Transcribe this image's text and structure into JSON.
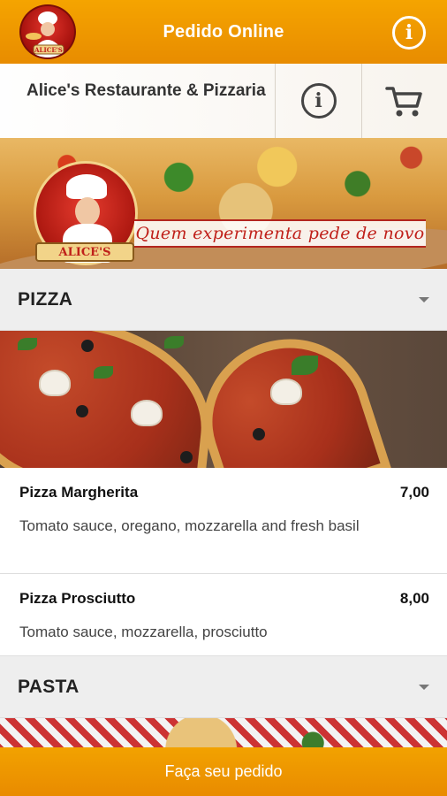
{
  "app_bar": {
    "title": "Pedido Online",
    "logo_text": "ALICE'S",
    "logo_icon": "chef-logo-icon",
    "info_icon": "info-icon"
  },
  "restaurant": {
    "name": "Alice's Restaurante & Pizzaria",
    "info_icon": "info-icon",
    "cart_icon": "cart-icon"
  },
  "banner": {
    "badge_text": "ALICE'S",
    "slogan": "Quem experimenta pede de novo"
  },
  "categories": [
    {
      "title": "PIZZA",
      "expand_icon": "chevron-down-icon",
      "items": [
        {
          "name": "Pizza Margherita",
          "price": "7,00",
          "description": "Tomato sauce, oregano, mozzarella and fresh basil"
        },
        {
          "name": "Pizza Prosciutto",
          "price": "8,00",
          "description": "Tomato sauce, mozzarella, prosciutto"
        }
      ]
    },
    {
      "title": "PASTA",
      "expand_icon": "chevron-down-icon"
    }
  ],
  "footer": {
    "order_button": "Faça seu pedido"
  },
  "colors": {
    "brand_orange": "#f0a000",
    "header_gray": "#eeeeee",
    "slogan_red": "#c0201a"
  }
}
